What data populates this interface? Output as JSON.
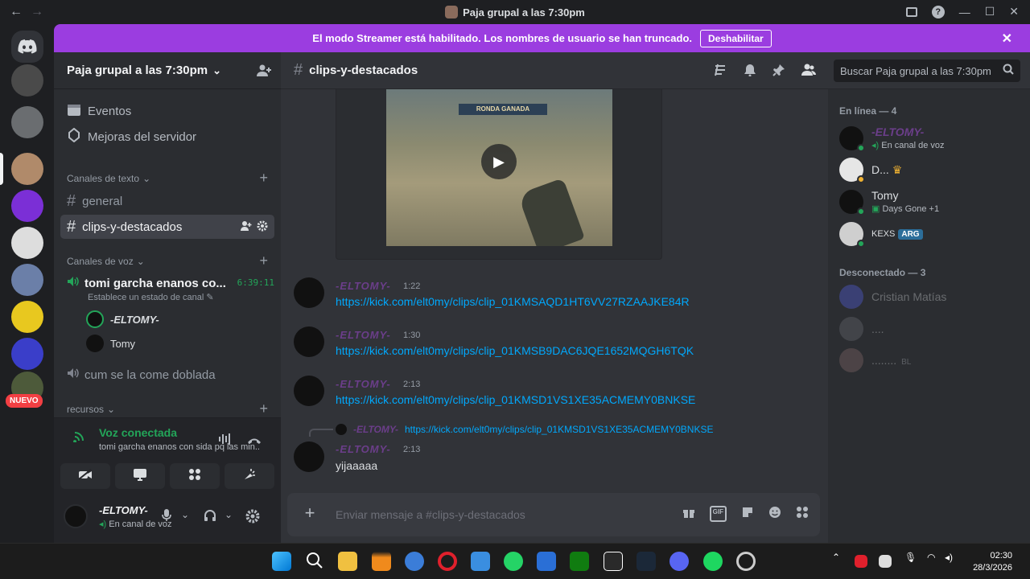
{
  "window": {
    "title": "Paja grupal a las 7:30pm",
    "back": "←",
    "forward": "→",
    "help": "?",
    "minimize": "—",
    "maximize": "☐",
    "close": "✕"
  },
  "banner": {
    "text": "El modo Streamer está habilitado. Los nombres de usuario se han truncado.",
    "button": "Deshabilitar",
    "close": "✕",
    "color": "#9b3de0"
  },
  "servers": {
    "new_badge": "NUEVO"
  },
  "sidebar": {
    "guild_name": "Paja grupal a las 7:30pm",
    "chevron": "⌄",
    "events": "Eventos",
    "boosts": "Mejoras del servidor",
    "text_category": "Canales de texto",
    "voice_category": "Canales de voz",
    "resources_category": "recursos",
    "channels": [
      {
        "name": "general"
      },
      {
        "name": "clips-y-destacados"
      }
    ],
    "voice_channel": {
      "name": "tomi garcha enanos co...",
      "timer": "6:39:11",
      "status": "Establece un estado de canal",
      "users": [
        "-ELTOMY-",
        "Tomy"
      ]
    },
    "voice_channel_2": "cum se la come doblada"
  },
  "voice_panel": {
    "title": "Voz conectada",
    "subtitle": "tomi garcha enanos con sida pq las min..."
  },
  "user_panel": {
    "name": "-ELTOMY-",
    "status": "En canal de voz"
  },
  "channel": {
    "name": "clips-y-destacados",
    "search_placeholder": "Buscar Paja grupal a las 7:30pm"
  },
  "embed": {
    "hud_text": "RONDA GANADA"
  },
  "messages": [
    {
      "author": "-ELTOMY-",
      "time": "1:22",
      "link": "https://kick.com/elt0my/clips/clip_01KMSAQD1HT6VV27RZAAJKE84R"
    },
    {
      "author": "-ELTOMY-",
      "time": "1:30",
      "link": "https://kick.com/elt0my/clips/clip_01KMSB9DAC6JQE1652MQGH6TQK"
    },
    {
      "author": "-ELTOMY-",
      "time": "2:13",
      "link": "https://kick.com/elt0my/clips/clip_01KMSD1VS1XE35ACMEMY0BNKSE"
    }
  ],
  "reply": {
    "author": "-ELTOMY-",
    "link": "https://kick.com/elt0my/clips/clip_01KMSD1VS1XE35ACMEMY0BNKSE"
  },
  "last_message": {
    "author": "-ELTOMY-",
    "time": "2:13",
    "text": "yijaaaaa"
  },
  "composer": {
    "placeholder": "Enviar mensaje a #clips-y-destacados",
    "gif": "GIF"
  },
  "members": {
    "online_header": "En línea — 4",
    "offline_header": "Desconectado — 3",
    "online": [
      {
        "name": "-ELTOMY-",
        "status": "En canal de voz"
      },
      {
        "name": "D...",
        "status": ""
      },
      {
        "name": "Tomy",
        "status": "Days Gone +1"
      },
      {
        "name": "KEXS",
        "tag": "ARG"
      }
    ],
    "offline": [
      {
        "name": "Cristian Matías"
      },
      {
        "name": "...."
      },
      {
        "name": "........",
        "tag": "BL"
      }
    ]
  },
  "taskbar": {
    "time": "02:30",
    "date": "28/3/2026"
  },
  "colors": {
    "link": "#00a8fc",
    "online": "#23a559",
    "accent": "#9b3de0"
  }
}
